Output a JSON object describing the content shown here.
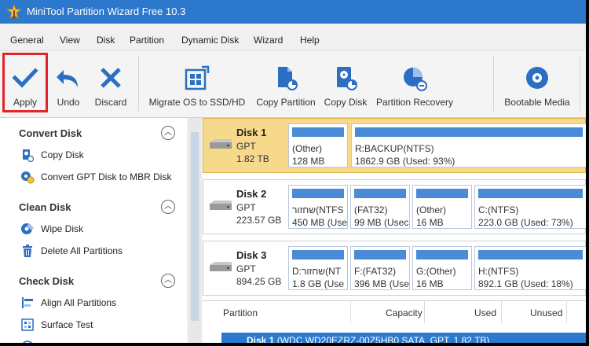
{
  "titlebar": {
    "title": "MiniTool Partition Wizard Free 10.3"
  },
  "menu": [
    "General",
    "View",
    "Disk",
    "Partition",
    "Dynamic Disk",
    "Wizard",
    "Help"
  ],
  "toolbar": {
    "apply": "Apply",
    "undo": "Undo",
    "discard": "Discard",
    "migrate": "Migrate OS to SSD/HD",
    "copy_partition": "Copy Partition",
    "copy_disk": "Copy Disk",
    "partition_recovery": "Partition Recovery",
    "bootable_media": "Bootable Media"
  },
  "sidebar": {
    "convert": {
      "title": "Convert Disk",
      "items": [
        "Copy Disk",
        "Convert GPT Disk to MBR Disk"
      ]
    },
    "clean": {
      "title": "Clean Disk",
      "items": [
        "Wipe Disk",
        "Delete All Partitions"
      ]
    },
    "check": {
      "title": "Check Disk",
      "items": [
        "Align All Partitions",
        "Surface Test"
      ]
    }
  },
  "disks": [
    {
      "name": "Disk 1",
      "type": "GPT",
      "size": "1.82 TB",
      "parts": [
        {
          "label": "(Other)",
          "info": "128 MB"
        },
        {
          "label": "R:BACKUP(NTFS)",
          "info": "1862.9 GB (Used: 93%)"
        }
      ]
    },
    {
      "name": "Disk 2",
      "type": "GPT",
      "size": "223.57 GB",
      "parts": [
        {
          "label": "שחזור(NTFS",
          "info": "450 MB (Use"
        },
        {
          "label": "(FAT32)",
          "info": "99 MB (Usec"
        },
        {
          "label": "(Other)",
          "info": "16 MB"
        },
        {
          "label": "C:(NTFS)",
          "info": "223.0 GB (Used: 73%)"
        }
      ]
    },
    {
      "name": "Disk 3",
      "type": "GPT",
      "size": "894.25 GB",
      "parts": [
        {
          "label": "D:שחזור(NT",
          "info": "1.8 GB (Use"
        },
        {
          "label": "F:(FAT32)",
          "info": "396 MB (Use"
        },
        {
          "label": "G:(Other)",
          "info": "16 MB"
        },
        {
          "label": "H:(NTFS)",
          "info": "892.1 GB (Used: 18%)"
        }
      ]
    }
  ],
  "table": {
    "headers": [
      "Partition",
      "Capacity",
      "Used",
      "Unused"
    ],
    "row_disk": "Disk 1",
    "row_detail": "(WDC WD20EZRZ-00Z5HB0 SATA, GPT, 1.82 TB)"
  },
  "colors": {
    "titlebar": "#2b78cc",
    "accent": "#2b78cc",
    "selected_disk": "#f7d98b",
    "highlight": "#e0262b"
  }
}
